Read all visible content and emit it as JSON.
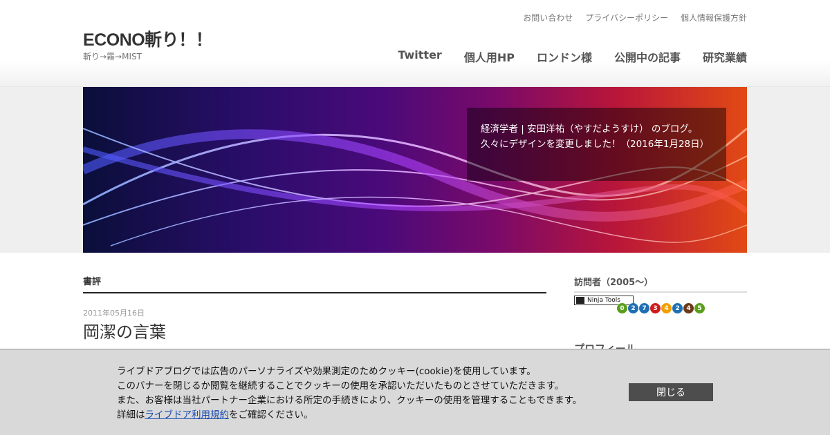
{
  "header": {
    "site_title": "ECONO斬り！！",
    "site_description": "斬り→霧→MIST",
    "util_nav": [
      "お問い合わせ",
      "プライバシーポリシー",
      "個人情報保護方針"
    ],
    "main_nav": [
      "Twitter",
      "個人用HP",
      "ロンドン様",
      "公開中の記事",
      "研究業績"
    ]
  },
  "banner": {
    "line1": "経済学者 | 安田洋祐（やすだようすけ） のブログ。",
    "line2": "久々にデザインを変更しました！（2016年1月28日）"
  },
  "content": {
    "category_title": "書評",
    "post_date": "2011年05月16日",
    "post_title": "岡潔の言葉"
  },
  "sidebar": {
    "visitors_title": "訪問者（2005～）",
    "ninja_label": "Ninja Tools",
    "counter_digits": [
      "0",
      "2",
      "7",
      "3",
      "4",
      "2",
      "4",
      "5"
    ],
    "counter_colors": [
      "#5a9e1a",
      "#1f6fb5",
      "#1f6fb5",
      "#d01c1c",
      "#f0a000",
      "#1f6fb5",
      "#6b3a1a",
      "#5a9e1a"
    ],
    "profile_title": "プロフィール"
  },
  "cookie": {
    "line1": "ライブドアブログでは広告のパーソナライズや効果測定のためクッキー(cookie)を使用しています。",
    "line2": "このバナーを閉じるか閲覧を継続することでクッキーの使用を承認いただいたものとさせていただきます。",
    "line3": "また、お客様は当社パートナー企業における所定の手続きにより、クッキーの使用を管理することもできます。",
    "line4_prefix": "詳細は",
    "line4_link": "ライブドア利用規約",
    "line4_suffix": "をご確認ください。",
    "close_label": "閉じる"
  }
}
